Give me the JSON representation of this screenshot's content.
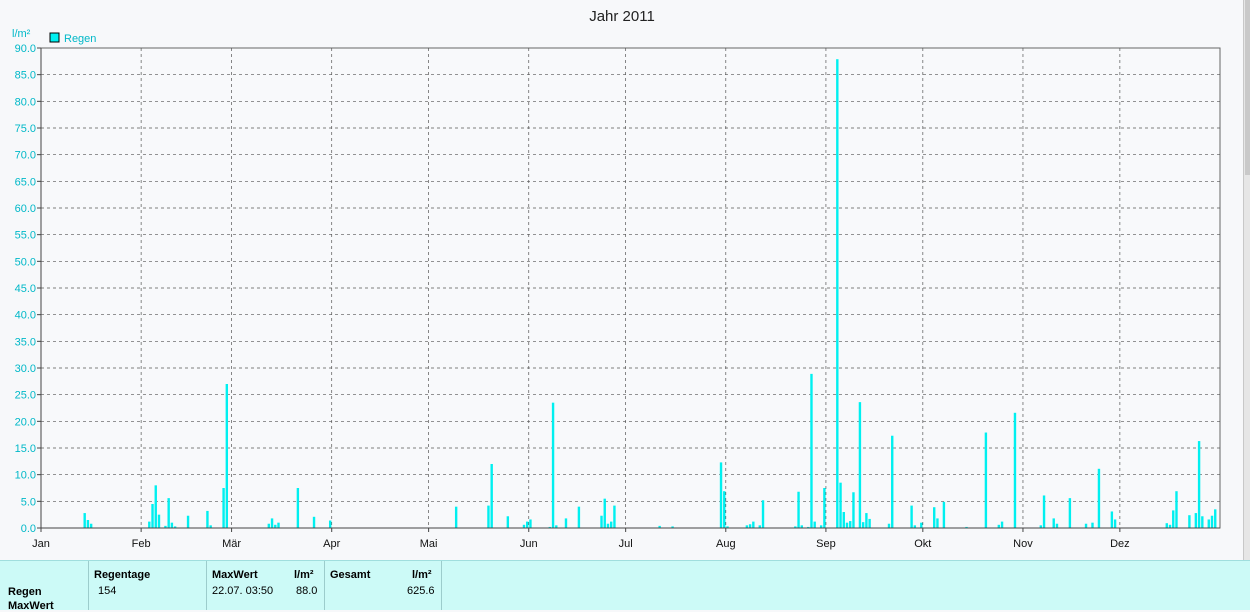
{
  "chart_data": {
    "type": "bar",
    "title": "Jahr 2011",
    "ylabel": "l/m²",
    "ylim": [
      0,
      90
    ],
    "yticks": [
      "0.0",
      "5.0",
      "10.0",
      "15.0",
      "20.0",
      "25.0",
      "30.0",
      "35.0",
      "40.0",
      "45.0",
      "50.0",
      "55.0",
      "60.0",
      "65.0",
      "70.0",
      "75.0",
      "80.0",
      "85.0",
      "90.0"
    ],
    "xticks": [
      "Jan",
      "Feb",
      "Mär",
      "Apr",
      "Mai",
      "Jun",
      "Jul",
      "Aug",
      "Sep",
      "Okt",
      "Nov",
      "Dez"
    ],
    "grid": true,
    "legend_position": "top-left",
    "series": [
      {
        "name": "Regen",
        "color": "#00f0f0",
        "day_of_year": [
          14,
          15,
          16,
          34,
          35,
          36,
          37,
          39,
          40,
          41,
          42,
          46,
          52,
          53,
          57,
          58,
          71,
          72,
          73,
          74,
          80,
          85,
          90,
          129,
          139,
          140,
          145,
          150,
          151,
          152,
          158,
          159,
          160,
          163,
          167,
          174,
          175,
          176,
          177,
          178,
          192,
          196,
          211,
          212,
          213,
          219,
          220,
          221,
          223,
          224,
          234,
          235,
          236,
          238,
          239,
          240,
          242,
          243,
          247,
          248,
          249,
          250,
          251,
          252,
          254,
          255,
          256,
          257,
          263,
          264,
          270,
          271,
          273,
          277,
          278,
          280,
          287,
          293,
          297,
          298,
          302,
          310,
          311,
          314,
          315,
          319,
          324,
          326,
          328,
          332,
          333,
          349,
          350,
          351,
          352,
          356,
          358,
          359,
          360,
          362,
          363,
          364
        ],
        "values": [
          2.8,
          1.5,
          0.8,
          1.2,
          4.5,
          8.0,
          2.5,
          0.4,
          5.6,
          1.0,
          0.3,
          2.3,
          3.2,
          0.5,
          7.5,
          27.0,
          0.8,
          1.8,
          0.6,
          1.0,
          7.5,
          2.1,
          1.4,
          4.0,
          4.2,
          12.0,
          2.2,
          0.6,
          1.2,
          1.6,
          0.2,
          23.5,
          0.5,
          1.8,
          4.0,
          2.3,
          5.5,
          0.8,
          1.2,
          4.2,
          0.4,
          0.3,
          12.3,
          6.9,
          0.3,
          0.5,
          0.7,
          1.2,
          0.5,
          5.2,
          0.3,
          6.8,
          0.5,
          0.2,
          28.9,
          1.2,
          0.5,
          7.5,
          87.9,
          8.5,
          3.0,
          1.0,
          1.3,
          6.7,
          23.6,
          1.1,
          2.8,
          1.7,
          0.8,
          17.3,
          4.2,
          0.5,
          1.0,
          3.9,
          1.8,
          4.9,
          0.2,
          17.9,
          0.6,
          1.2,
          21.6,
          0.5,
          6.1,
          1.8,
          0.8,
          5.6,
          0.8,
          1.0,
          11.1,
          3.1,
          1.6,
          0.9,
          0.6,
          3.3,
          6.9,
          2.4,
          2.8,
          16.3,
          2.2,
          1.6,
          2.3,
          3.5
        ]
      }
    ]
  },
  "stats": {
    "regentage_header": "Regentage",
    "maxwert_header": "MaxWert",
    "unit_header1": "l/m²",
    "gesamt_header": "Gesamt",
    "unit_header2": "l/m²",
    "row1_label": "Regen",
    "row1_regentage": "154",
    "row1_date": "22.07.  03:50",
    "row1_max": "88.0",
    "row1_total": "625.6",
    "row2_label": "MaxWert"
  }
}
